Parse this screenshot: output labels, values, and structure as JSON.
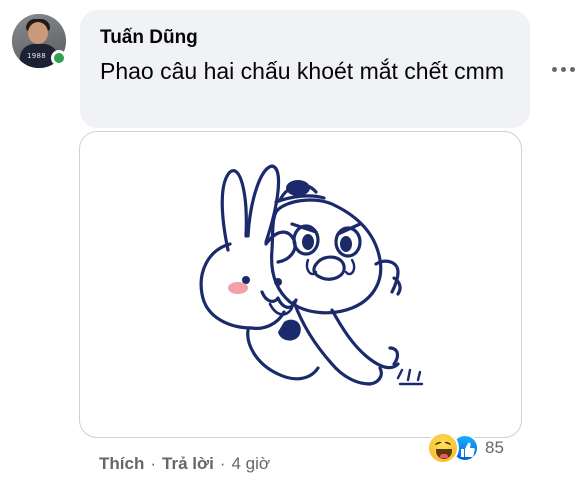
{
  "comment": {
    "author": "Tuấn Dũng",
    "text": "Phao câu hai chấu khoét mắt chết cmm",
    "online": true
  },
  "avatar": {
    "shirt_text": "1988"
  },
  "sticker": {
    "description_icon": "sticker-rabbit-and-bean-icon"
  },
  "actions": {
    "like_label": "Thích",
    "separator": "·",
    "reply_label": "Trả lời",
    "time": "4 giờ"
  },
  "reactions": {
    "icons": [
      "haha-icon",
      "like-icon"
    ],
    "count": "85"
  },
  "colors": {
    "bubble_bg": "#f0f2f5",
    "secondary_text": "#65676b",
    "online": "#31a24c",
    "sticker_ink": "#1a2a6b",
    "like_blue": "#0a7cff"
  }
}
